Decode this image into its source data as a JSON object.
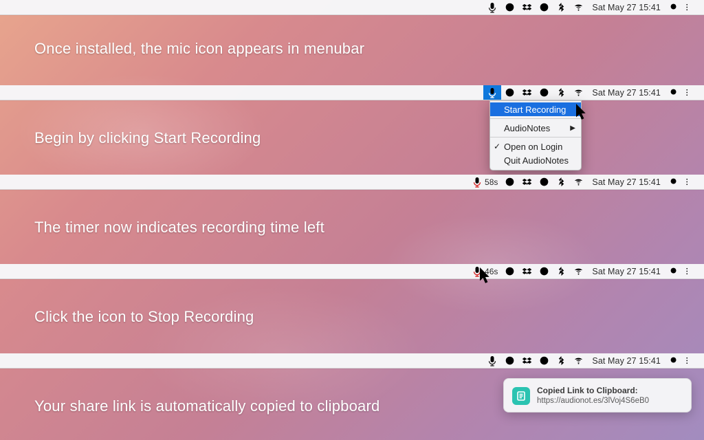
{
  "clock": "Sat May 27  15:41",
  "steps": {
    "s1": {
      "caption": "Once installed, the mic icon appears in menubar"
    },
    "s2": {
      "caption": "Begin by clicking Start Recording"
    },
    "s3": {
      "caption": "The timer now indicates recording time left",
      "timer": "58s"
    },
    "s4": {
      "caption": "Click the icon to Stop Recording",
      "timer": "46s"
    },
    "s5": {
      "caption": "Your share link is automatically copied to clipboard"
    }
  },
  "menu": {
    "start": "Start Recording",
    "audionotes": "AudioNotes",
    "open_login": "Open on Login",
    "quit": "Quit AudioNotes"
  },
  "notification": {
    "title": "Copied Link to Clipboard:",
    "body": "https://audionot.es/3lVoj4S6eB0"
  }
}
